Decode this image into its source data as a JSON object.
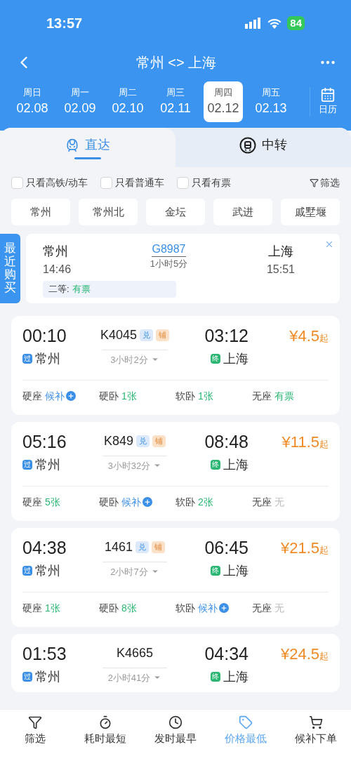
{
  "status_bar": {
    "time": "13:57",
    "battery": "84"
  },
  "header": {
    "title": "常州 <> 上海"
  },
  "dates": [
    {
      "weekday": "周日",
      "date": "02.08",
      "selected": false
    },
    {
      "weekday": "周一",
      "date": "02.09",
      "selected": false
    },
    {
      "weekday": "周二",
      "date": "02.10",
      "selected": false
    },
    {
      "weekday": "周三",
      "date": "02.11",
      "selected": false
    },
    {
      "weekday": "周四",
      "date": "02.12",
      "selected": true
    },
    {
      "weekday": "周五",
      "date": "02.13",
      "selected": false
    }
  ],
  "calendar_label": "日历",
  "tabs": [
    {
      "label": "直达",
      "selected": true
    },
    {
      "label": "中转",
      "selected": false
    }
  ],
  "filters": [
    {
      "label": "只看高铁/动车",
      "checked": false
    },
    {
      "label": "只看普通车",
      "checked": false
    },
    {
      "label": "只看有票",
      "checked": false
    }
  ],
  "filter_button": "筛选",
  "stations": [
    "常州",
    "常州北",
    "金坛",
    "武进",
    "戚墅堰"
  ],
  "recent": {
    "tab": "最近购买",
    "from": "常州",
    "depart": "14:46",
    "train": "G8987",
    "duration": "1小时5分",
    "to": "上海",
    "arrive": "15:51",
    "seat_label": "二等:",
    "seat_status": "有票"
  },
  "trains": [
    {
      "depart": "00:10",
      "number": "K4045",
      "badges": [
        {
          "text": "兑",
          "kind": "exchange"
        },
        {
          "text": "铺",
          "kind": "berth"
        }
      ],
      "arrive": "03:12",
      "from_tag": "过",
      "from": "常州",
      "duration": "3小时2分",
      "to_tag": "终",
      "to": "上海",
      "price": "¥4.5",
      "price_suffix": "起",
      "seats": [
        {
          "label": "硬座",
          "value": "候补",
          "kind": "waitlist"
        },
        {
          "label": "硬卧",
          "value": "1张",
          "kind": "count"
        },
        {
          "label": "软卧",
          "value": "1张",
          "kind": "count"
        },
        {
          "label": "无座",
          "value": "有票",
          "kind": "count"
        }
      ]
    },
    {
      "depart": "05:16",
      "number": "K849",
      "badges": [
        {
          "text": "兑",
          "kind": "exchange"
        },
        {
          "text": "铺",
          "kind": "berth"
        }
      ],
      "arrive": "08:48",
      "from_tag": "过",
      "from": "常州",
      "duration": "3小时32分",
      "to_tag": "终",
      "to": "上海",
      "price": "¥11.5",
      "price_suffix": "起",
      "seats": [
        {
          "label": "硬座",
          "value": "5张",
          "kind": "count"
        },
        {
          "label": "硬卧",
          "value": "候补",
          "kind": "waitlist"
        },
        {
          "label": "软卧",
          "value": "2张",
          "kind": "count"
        },
        {
          "label": "无座",
          "value": "无",
          "kind": "none"
        }
      ]
    },
    {
      "depart": "04:38",
      "number": "1461",
      "badges": [
        {
          "text": "兑",
          "kind": "exchange"
        },
        {
          "text": "铺",
          "kind": "berth"
        }
      ],
      "arrive": "06:45",
      "from_tag": "过",
      "from": "常州",
      "duration": "2小时7分",
      "to_tag": "终",
      "to": "上海",
      "price": "¥21.5",
      "price_suffix": "起",
      "seats": [
        {
          "label": "硬座",
          "value": "1张",
          "kind": "count"
        },
        {
          "label": "硬卧",
          "value": "8张",
          "kind": "count"
        },
        {
          "label": "软卧",
          "value": "候补",
          "kind": "waitlist"
        },
        {
          "label": "无座",
          "value": "无",
          "kind": "none"
        }
      ]
    },
    {
      "depart": "01:53",
      "number": "K4665",
      "arrive": "04:34",
      "from_tag": "过",
      "from": "常州",
      "duration": "2小时41分",
      "to_tag": "终",
      "to": "上海",
      "price": "¥24.5",
      "price_suffix": "起"
    }
  ],
  "bottom_nav": [
    {
      "label": "筛选",
      "kind": "filter",
      "selected": false
    },
    {
      "label": "耗时最短",
      "kind": "timer",
      "selected": false
    },
    {
      "label": "发时最早",
      "kind": "clock",
      "selected": false
    },
    {
      "label": "价格最低",
      "kind": "tag",
      "selected": true
    },
    {
      "label": "候补下单",
      "kind": "cart",
      "selected": false
    }
  ]
}
